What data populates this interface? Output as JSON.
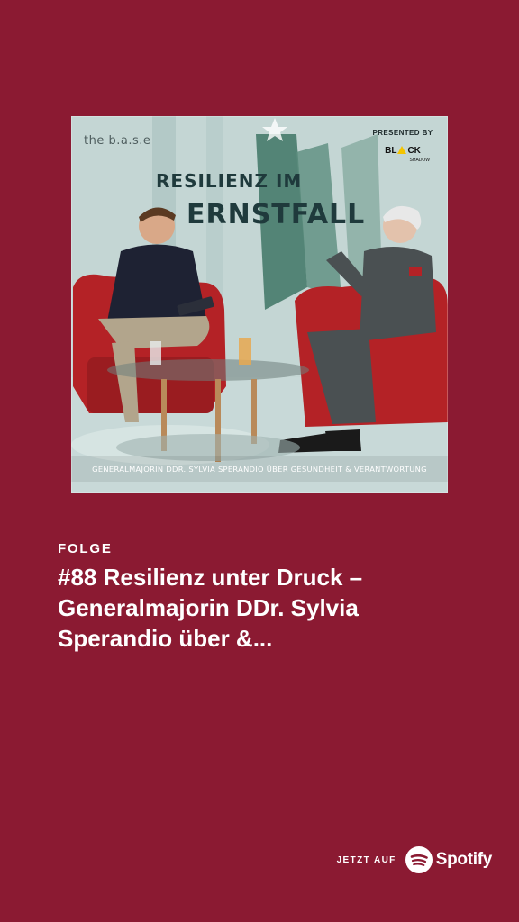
{
  "cover": {
    "brand": "the b.a.s.e",
    "presented_by": "PRESENTED BY",
    "sponsor_logo_pre": "BL",
    "sponsor_logo_post": "CK",
    "sponsor_sub": "SHADOW",
    "title_line1_a": "RESILIENZ",
    "title_line1_b": "IM",
    "title_line2": "ERNSTFALL",
    "caption": "GENERALMAJORIN DDR. SYLVIA SPERANDIO ÜBER GESUNDHEIT & VERANTWORTUNG"
  },
  "episode": {
    "kicker": "FOLGE",
    "title": "#88 Resilienz unter Druck – Generalmajorin DDr. Sylvia Sperandio über &..."
  },
  "cta": {
    "label": "JETZT AUF",
    "platform": "Spotify",
    "icon": "spotify-logo-icon"
  },
  "colors": {
    "background": "#8b1a32",
    "text": "#ffffff"
  }
}
